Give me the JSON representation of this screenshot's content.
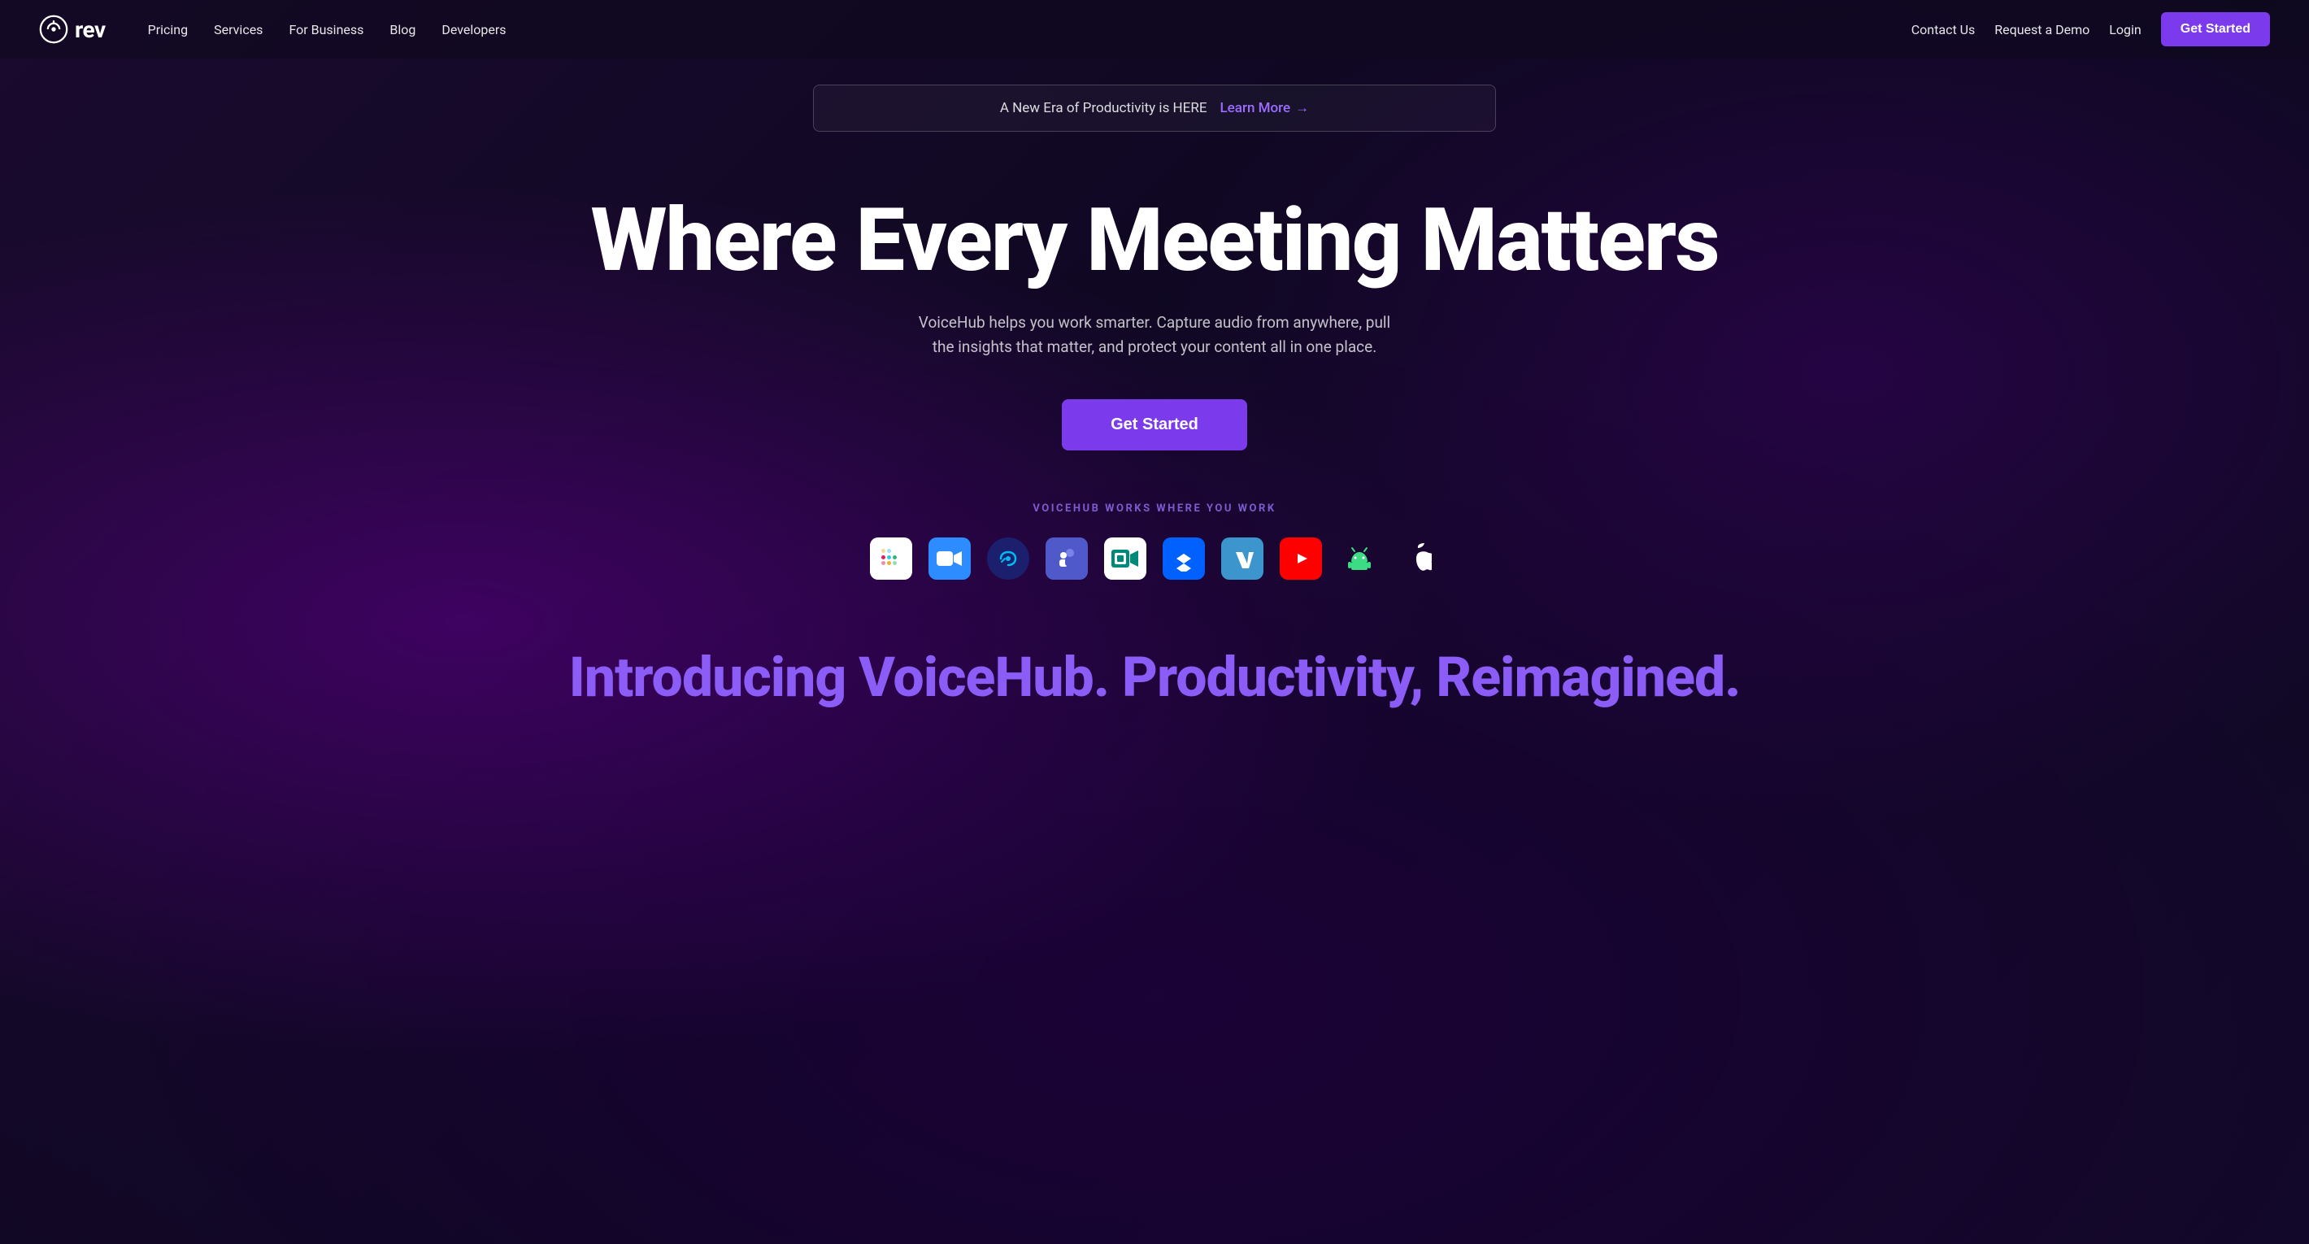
{
  "nav": {
    "logo_text": "rev",
    "links": [
      {
        "label": "Pricing",
        "id": "pricing"
      },
      {
        "label": "Services",
        "id": "services"
      },
      {
        "label": "For Business",
        "id": "for-business"
      },
      {
        "label": "Blog",
        "id": "blog"
      },
      {
        "label": "Developers",
        "id": "developers"
      }
    ],
    "right_links": [
      {
        "label": "Contact Us",
        "id": "contact-us"
      },
      {
        "label": "Request a Demo",
        "id": "request-demo"
      },
      {
        "label": "Login",
        "id": "login"
      }
    ],
    "cta_button": "Get Started"
  },
  "banner": {
    "text": "A New Era of Productivity is HERE",
    "link_text": "Learn More",
    "arrow": "→"
  },
  "hero": {
    "title": "Where Every Meeting Matters",
    "subtitle": "VoiceHub helps you work smarter. Capture audio from anywhere, pull the insights that matter, and protect your content all in one place.",
    "cta_button": "Get Started"
  },
  "integrations": {
    "label": "VOICEHUB WORKS WHERE YOU WORK",
    "icons": [
      {
        "name": "Slack",
        "id": "slack"
      },
      {
        "name": "Zoom",
        "id": "zoom"
      },
      {
        "name": "Webex",
        "id": "webex"
      },
      {
        "name": "Microsoft Teams",
        "id": "teams"
      },
      {
        "name": "Google Meet",
        "id": "gmeet"
      },
      {
        "name": "Dropbox",
        "id": "dropbox"
      },
      {
        "name": "Venmo",
        "id": "venmo"
      },
      {
        "name": "YouTube",
        "id": "youtube"
      },
      {
        "name": "Android",
        "id": "android"
      },
      {
        "name": "Apple",
        "id": "apple"
      }
    ]
  },
  "bottom": {
    "tagline": "Introducing VoiceHub. Productivity, Reimagined."
  }
}
